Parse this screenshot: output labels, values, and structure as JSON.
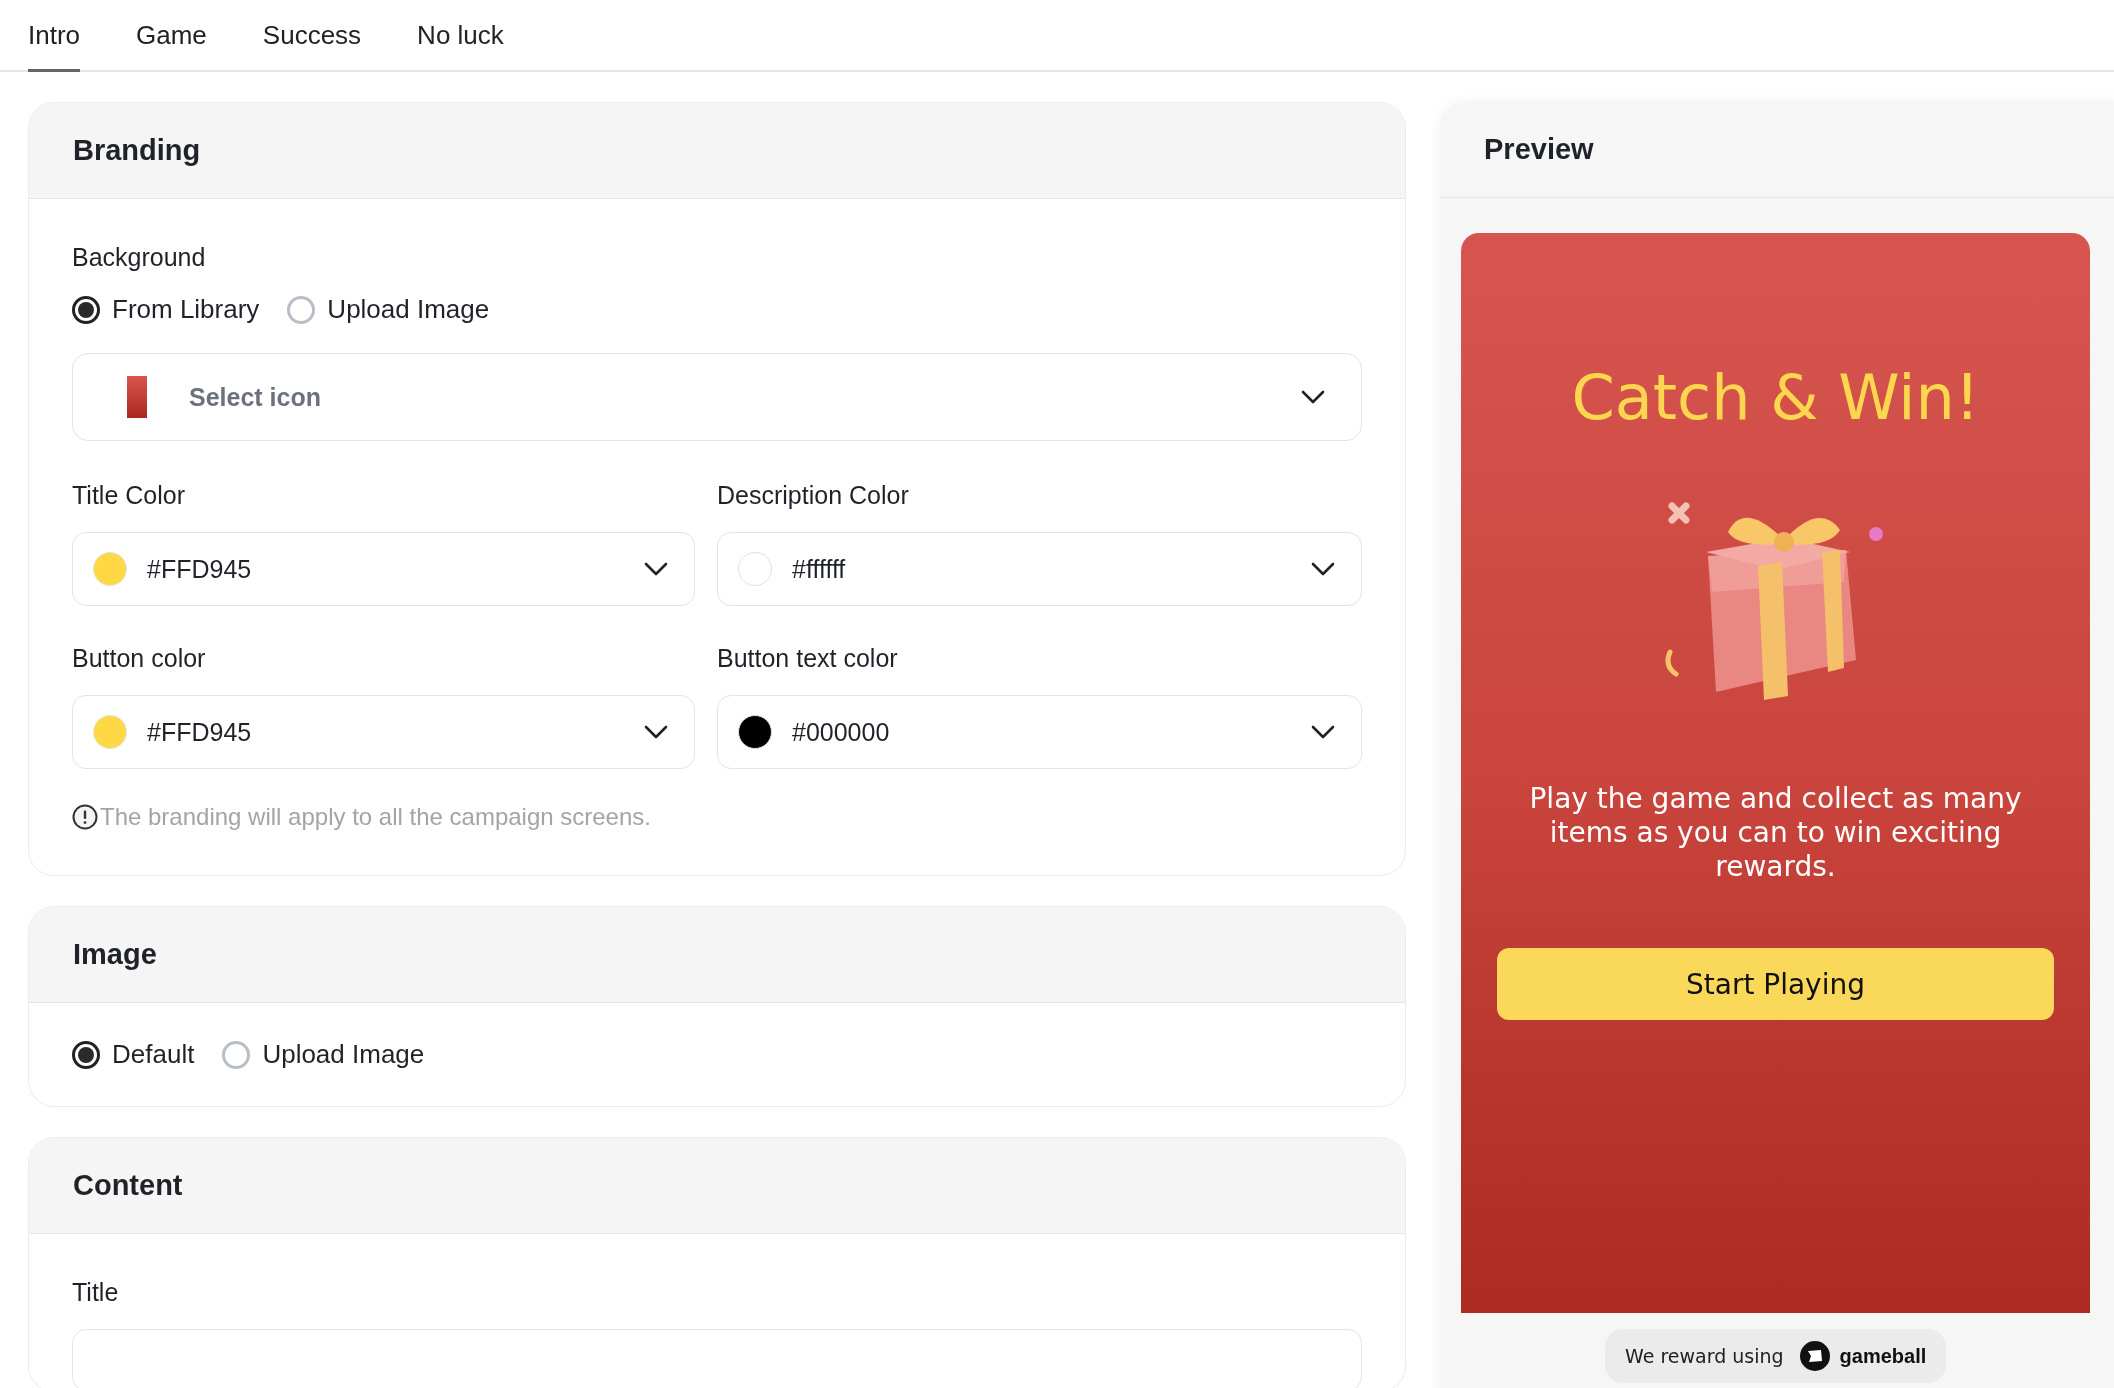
{
  "tabs": [
    {
      "label": "Intro",
      "selected": true
    },
    {
      "label": "Game",
      "selected": false
    },
    {
      "label": "Success",
      "selected": false
    },
    {
      "label": "No luck",
      "selected": false
    }
  ],
  "branding": {
    "title": "Branding",
    "background": {
      "label": "Background",
      "options": [
        {
          "label": "From Library",
          "selected": true
        },
        {
          "label": "Upload Image",
          "selected": false
        }
      ],
      "select": {
        "placeholder": "Select icon"
      }
    },
    "color_fields": [
      {
        "label": "Title Color",
        "value": "#FFD945",
        "color": "#ffd945"
      },
      {
        "label": "Description Color",
        "value": "#ffffff",
        "color": "#ffffff"
      },
      {
        "label": "Button color",
        "value": "#FFD945",
        "color": "#ffd945"
      },
      {
        "label": "Button text color",
        "value": "#000000",
        "color": "#000000"
      }
    ],
    "note": "The branding will apply to all the campaign screens."
  },
  "image": {
    "title": "Image",
    "options": [
      {
        "label": "Default",
        "selected": true
      },
      {
        "label": "Upload Image",
        "selected": false
      }
    ]
  },
  "content": {
    "title": "Content",
    "fields": [
      {
        "label": "Title"
      }
    ]
  },
  "preview": {
    "title": "Preview",
    "headline": "Catch & Win!",
    "description": "Play the game and collect as many items as you can to win exciting rewards.",
    "button": "Start Playing",
    "footer": {
      "text": "We reward using",
      "brand": "gameball"
    }
  }
}
